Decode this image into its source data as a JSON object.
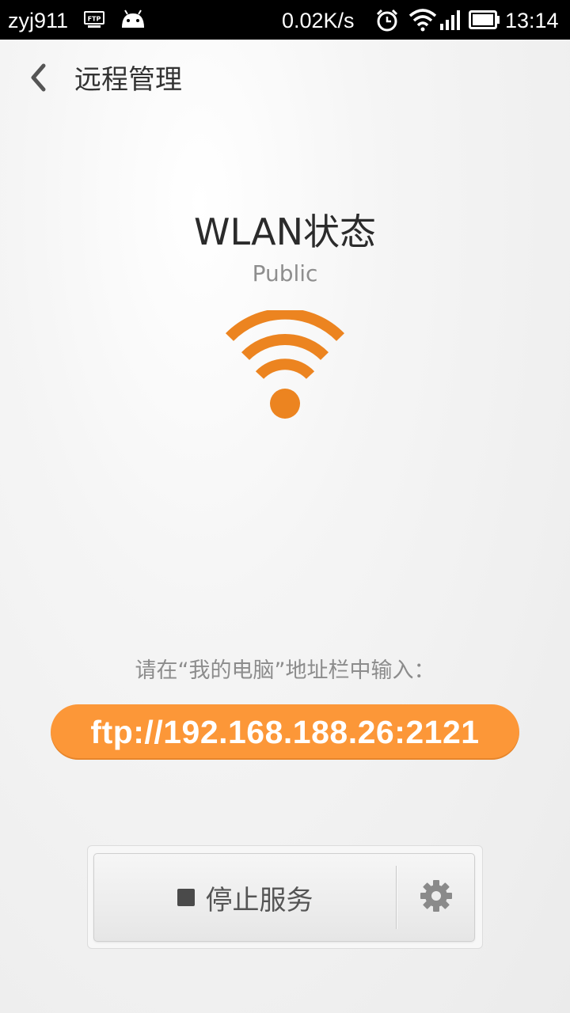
{
  "status_bar": {
    "user": "zyj911",
    "net_speed": "0.02K/s",
    "time": "13:14",
    "icons": [
      "ftp-icon",
      "android-icon",
      "alarm-icon",
      "wifi-signal-icon",
      "cell-signal-icon",
      "battery-icon"
    ]
  },
  "header": {
    "title": "远程管理",
    "back_icon": "chevron-left-icon"
  },
  "wlan": {
    "title": "WLAN状态",
    "network": "Public",
    "icon": "wifi-icon",
    "accent": "#ec8420"
  },
  "connect": {
    "instruction": "请在“我的电脑”地址栏中输入：",
    "address": "ftp://192.168.188.26:2121",
    "pill_color": "#fc9738"
  },
  "controls": {
    "stop_label": "停止服务",
    "stop_icon": "stop-square-icon",
    "settings_icon": "gear-icon"
  }
}
